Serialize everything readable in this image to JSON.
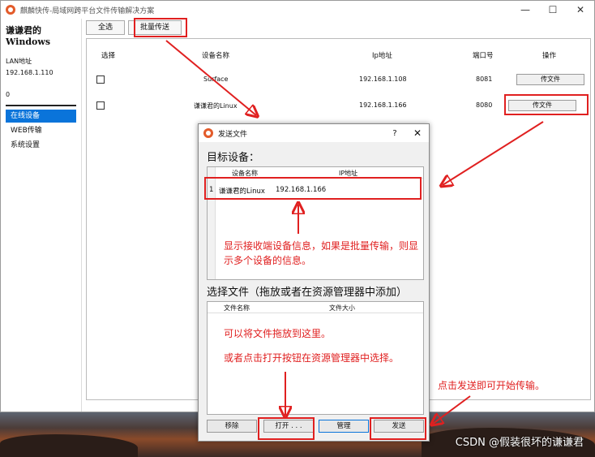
{
  "app": {
    "title": "麒麟快传-局域网跨平台文件传输解决方案",
    "controls": [
      "—",
      "☐",
      "✕"
    ]
  },
  "sidebar": {
    "brand": "谦谦君的Windows",
    "lan_label": "LAN地址",
    "lan_ip": "192.168.1.110",
    "count": "0",
    "items": [
      {
        "label": "在线设备",
        "active": true
      },
      {
        "label": "WEB传输",
        "active": false
      },
      {
        "label": "系统设置",
        "active": false
      }
    ]
  },
  "toolbar": {
    "select_all": "全选",
    "batch_send": "批量传送"
  },
  "devices": {
    "columns": {
      "select": "选择",
      "name": "设备名称",
      "ip": "Ip地址",
      "port": "端口号",
      "action": "操作"
    },
    "rows": [
      {
        "name": "Surface",
        "ip": "192.168.1.108",
        "port": "8081",
        "action": "传文件"
      },
      {
        "name": "谦谦君的Linux",
        "ip": "192.168.1.166",
        "port": "8080",
        "action": "传文件"
      }
    ]
  },
  "dialog": {
    "title": "发送文件",
    "help": "?",
    "close": "✕",
    "target_heading": "目标设备：",
    "target_columns": {
      "name": "设备名称",
      "ip": "IP地址"
    },
    "target_row": {
      "index": "1",
      "name": "谦谦君的Linux",
      "ip": "192.168.1.166"
    },
    "file_heading": "选择文件（拖放或者在资源管理器中添加）",
    "file_columns": {
      "name": "文件名称",
      "size": "文件大小"
    },
    "buttons": {
      "remove": "移除",
      "open": "打开 . . .",
      "manage": "管理",
      "send": "发送"
    }
  },
  "annotations": {
    "note1": "显示接收端设备信息，如果是批量传输，则显示多个设备的信息。",
    "note2": "可以将文件拖放到这里。",
    "note3": "或者点击打开按钮在资源管理器中选择。",
    "note4": "点击发送即可开始传输。",
    "color": "#e02020"
  },
  "watermark": "CSDN @假装很坏的谦谦君",
  "colors": {
    "accent": "#0a74da",
    "annotation": "#e02020"
  }
}
